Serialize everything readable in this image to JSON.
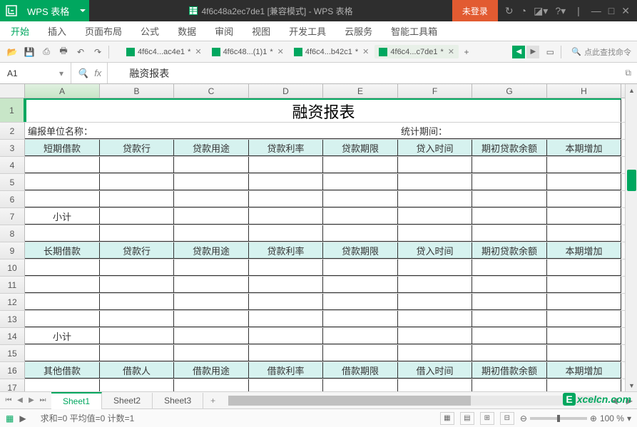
{
  "titlebar": {
    "app_name": "WPS 表格",
    "doc_title": "4f6c48a2ec7de1 [兼容模式] - WPS 表格",
    "login": "未登录"
  },
  "menu": {
    "items": [
      "开始",
      "插入",
      "页面布局",
      "公式",
      "数据",
      "审阅",
      "视图",
      "开发工具",
      "云服务",
      "智能工具箱"
    ],
    "active": 0
  },
  "doctabs": {
    "items": [
      {
        "label": "4f6c4...ac4e1",
        "dirty": "*"
      },
      {
        "label": "4f6c48...(1)1",
        "dirty": " *"
      },
      {
        "label": "4f6c4...b42c1",
        "dirty": " *"
      },
      {
        "label": "4f6c4...c7de1",
        "dirty": " *"
      }
    ],
    "search_placeholder": "点此查找命令"
  },
  "formula": {
    "cell": "A1",
    "fx": "fx",
    "content": "融资报表"
  },
  "columns": [
    "A",
    "B",
    "C",
    "D",
    "E",
    "F",
    "G",
    "H"
  ],
  "rows": [
    "1",
    "2",
    "3",
    "4",
    "5",
    "6",
    "7",
    "8",
    "9",
    "10",
    "11",
    "12",
    "13",
    "14",
    "15",
    "16",
    "17"
  ],
  "sheet": {
    "title": "融资报表",
    "row2": {
      "label1": "编报单位名称：",
      "label2": "统计期间："
    },
    "hdr1": [
      "短期借款",
      "贷款行",
      "贷款用途",
      "贷款利率",
      "贷款期限",
      "贷入时间",
      "期初贷款余额",
      "本期增加"
    ],
    "subtotal": "小计",
    "hdr2": [
      "长期借款",
      "贷款行",
      "贷款用途",
      "贷款利率",
      "贷款期限",
      "贷入时间",
      "期初贷款余额",
      "本期增加"
    ],
    "hdr3": [
      "其他借款",
      "借款人",
      "借款用途",
      "借款利率",
      "借款期限",
      "借入时间",
      "期初借款余额",
      "本期增加"
    ]
  },
  "sheettabs": {
    "items": [
      "Sheet1",
      "Sheet2",
      "Sheet3"
    ],
    "active": 0
  },
  "status": {
    "stats": "求和=0  平均值=0  计数=1",
    "zoom": "100 %"
  },
  "watermark": {
    "text": "xcelcn.com",
    "E": "E"
  }
}
